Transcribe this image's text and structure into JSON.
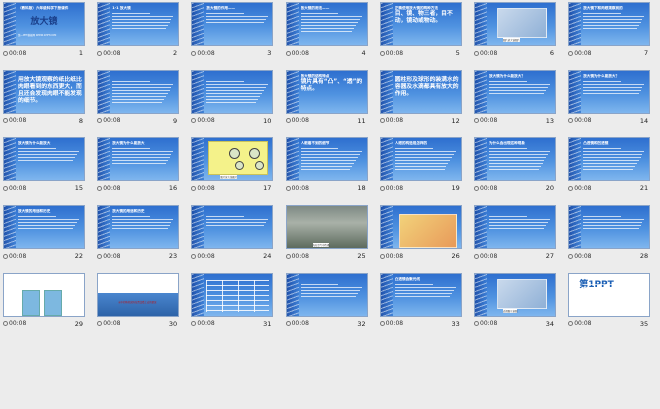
{
  "time_label": "00:08",
  "slides": [
    {
      "n": "1",
      "kind": "title",
      "title": "（教科版）六年级科学下册课件",
      "big": "放大镜",
      "sub": "第一PPT模板网 WWW.1PPT.COM"
    },
    {
      "n": "2",
      "kind": "text",
      "title": "1-1 放大镜",
      "lines": 6
    },
    {
      "n": "3",
      "kind": "text",
      "title": "放大镜的作用——",
      "lines": 4
    },
    {
      "n": "4",
      "kind": "text",
      "title": "放大镜的用法——",
      "lines": 7
    },
    {
      "n": "5",
      "kind": "bigtext",
      "title": "正确使用放大镜的两种方法",
      "big": "目、镜、物三者，目不动，镜动或物动。"
    },
    {
      "n": "6",
      "kind": "picture",
      "caption": "图片放大镜图片"
    },
    {
      "n": "7",
      "kind": "text",
      "title": "放大镜下和肉眼观察到的",
      "lines": 6
    },
    {
      "n": "8",
      "kind": "bigtext",
      "title": "",
      "big": "用放大镜观察的纸比纸比肉眼看到的东西更大，而且还会发现肉眼不能发现的细节。"
    },
    {
      "n": "9",
      "kind": "text",
      "title": "",
      "lines": 8
    },
    {
      "n": "10",
      "kind": "text",
      "title": "",
      "lines": 8
    },
    {
      "n": "11",
      "kind": "bigtext",
      "title": "放大镜的结构特点",
      "big": "镜片具有“凸”、“透”的特点。"
    },
    {
      "n": "12",
      "kind": "bigtext",
      "title": "",
      "big": "圆柱形及球形的装满水的容器及水滴都具有放大的作用。"
    },
    {
      "n": "13",
      "kind": "text",
      "title": "放大镜为什么能放大？",
      "lines": 5
    },
    {
      "n": "14",
      "kind": "text",
      "title": "放大镜为什么能放大？",
      "lines": 5
    },
    {
      "n": "15",
      "kind": "text",
      "title": "放大镜为什么能放大",
      "lines": 5
    },
    {
      "n": "16",
      "kind": "text",
      "title": "放大镜为什么能放大",
      "lines": 6
    },
    {
      "n": "17",
      "kind": "lenses",
      "caption": "图片放大镜图片"
    },
    {
      "n": "18",
      "kind": "text",
      "title": "人眼看不到的细节",
      "lines": 8
    },
    {
      "n": "19",
      "kind": "text",
      "title": "人眼的构造是怎样的",
      "lines": 8
    },
    {
      "n": "20",
      "kind": "text",
      "title": "为什么会出现这种现象",
      "lines": 8
    },
    {
      "n": "21",
      "kind": "text",
      "title": "凸透镜和凹透镜",
      "lines": 8
    },
    {
      "n": "22",
      "kind": "text",
      "title": "放大镜的用途和历史",
      "lines": 5
    },
    {
      "n": "23",
      "kind": "text",
      "title": "放大镜的用途和历史",
      "lines": 5
    },
    {
      "n": "24",
      "kind": "text",
      "title": "",
      "lines": 4
    },
    {
      "n": "25",
      "kind": "photo",
      "caption": "光在空气中传播"
    },
    {
      "n": "26",
      "kind": "cartoon",
      "caption": ""
    },
    {
      "n": "27",
      "kind": "text",
      "title": "",
      "lines": 5
    },
    {
      "n": "28",
      "kind": "text",
      "title": "",
      "lines": 5
    },
    {
      "n": "29",
      "kind": "glass",
      "caption": ""
    },
    {
      "n": "30",
      "kind": "fishing",
      "caption": "水中的鱼的实际位置比看上去的要深"
    },
    {
      "n": "31",
      "kind": "table",
      "caption": ""
    },
    {
      "n": "32",
      "kind": "text",
      "title": "",
      "lines": 5
    },
    {
      "n": "33",
      "kind": "text",
      "title": "凸透镜会聚光线",
      "lines": 5
    },
    {
      "n": "34",
      "kind": "picture",
      "caption": "近视眼示意图"
    },
    {
      "n": "35",
      "kind": "logo",
      "caption": "第1PPT"
    }
  ]
}
